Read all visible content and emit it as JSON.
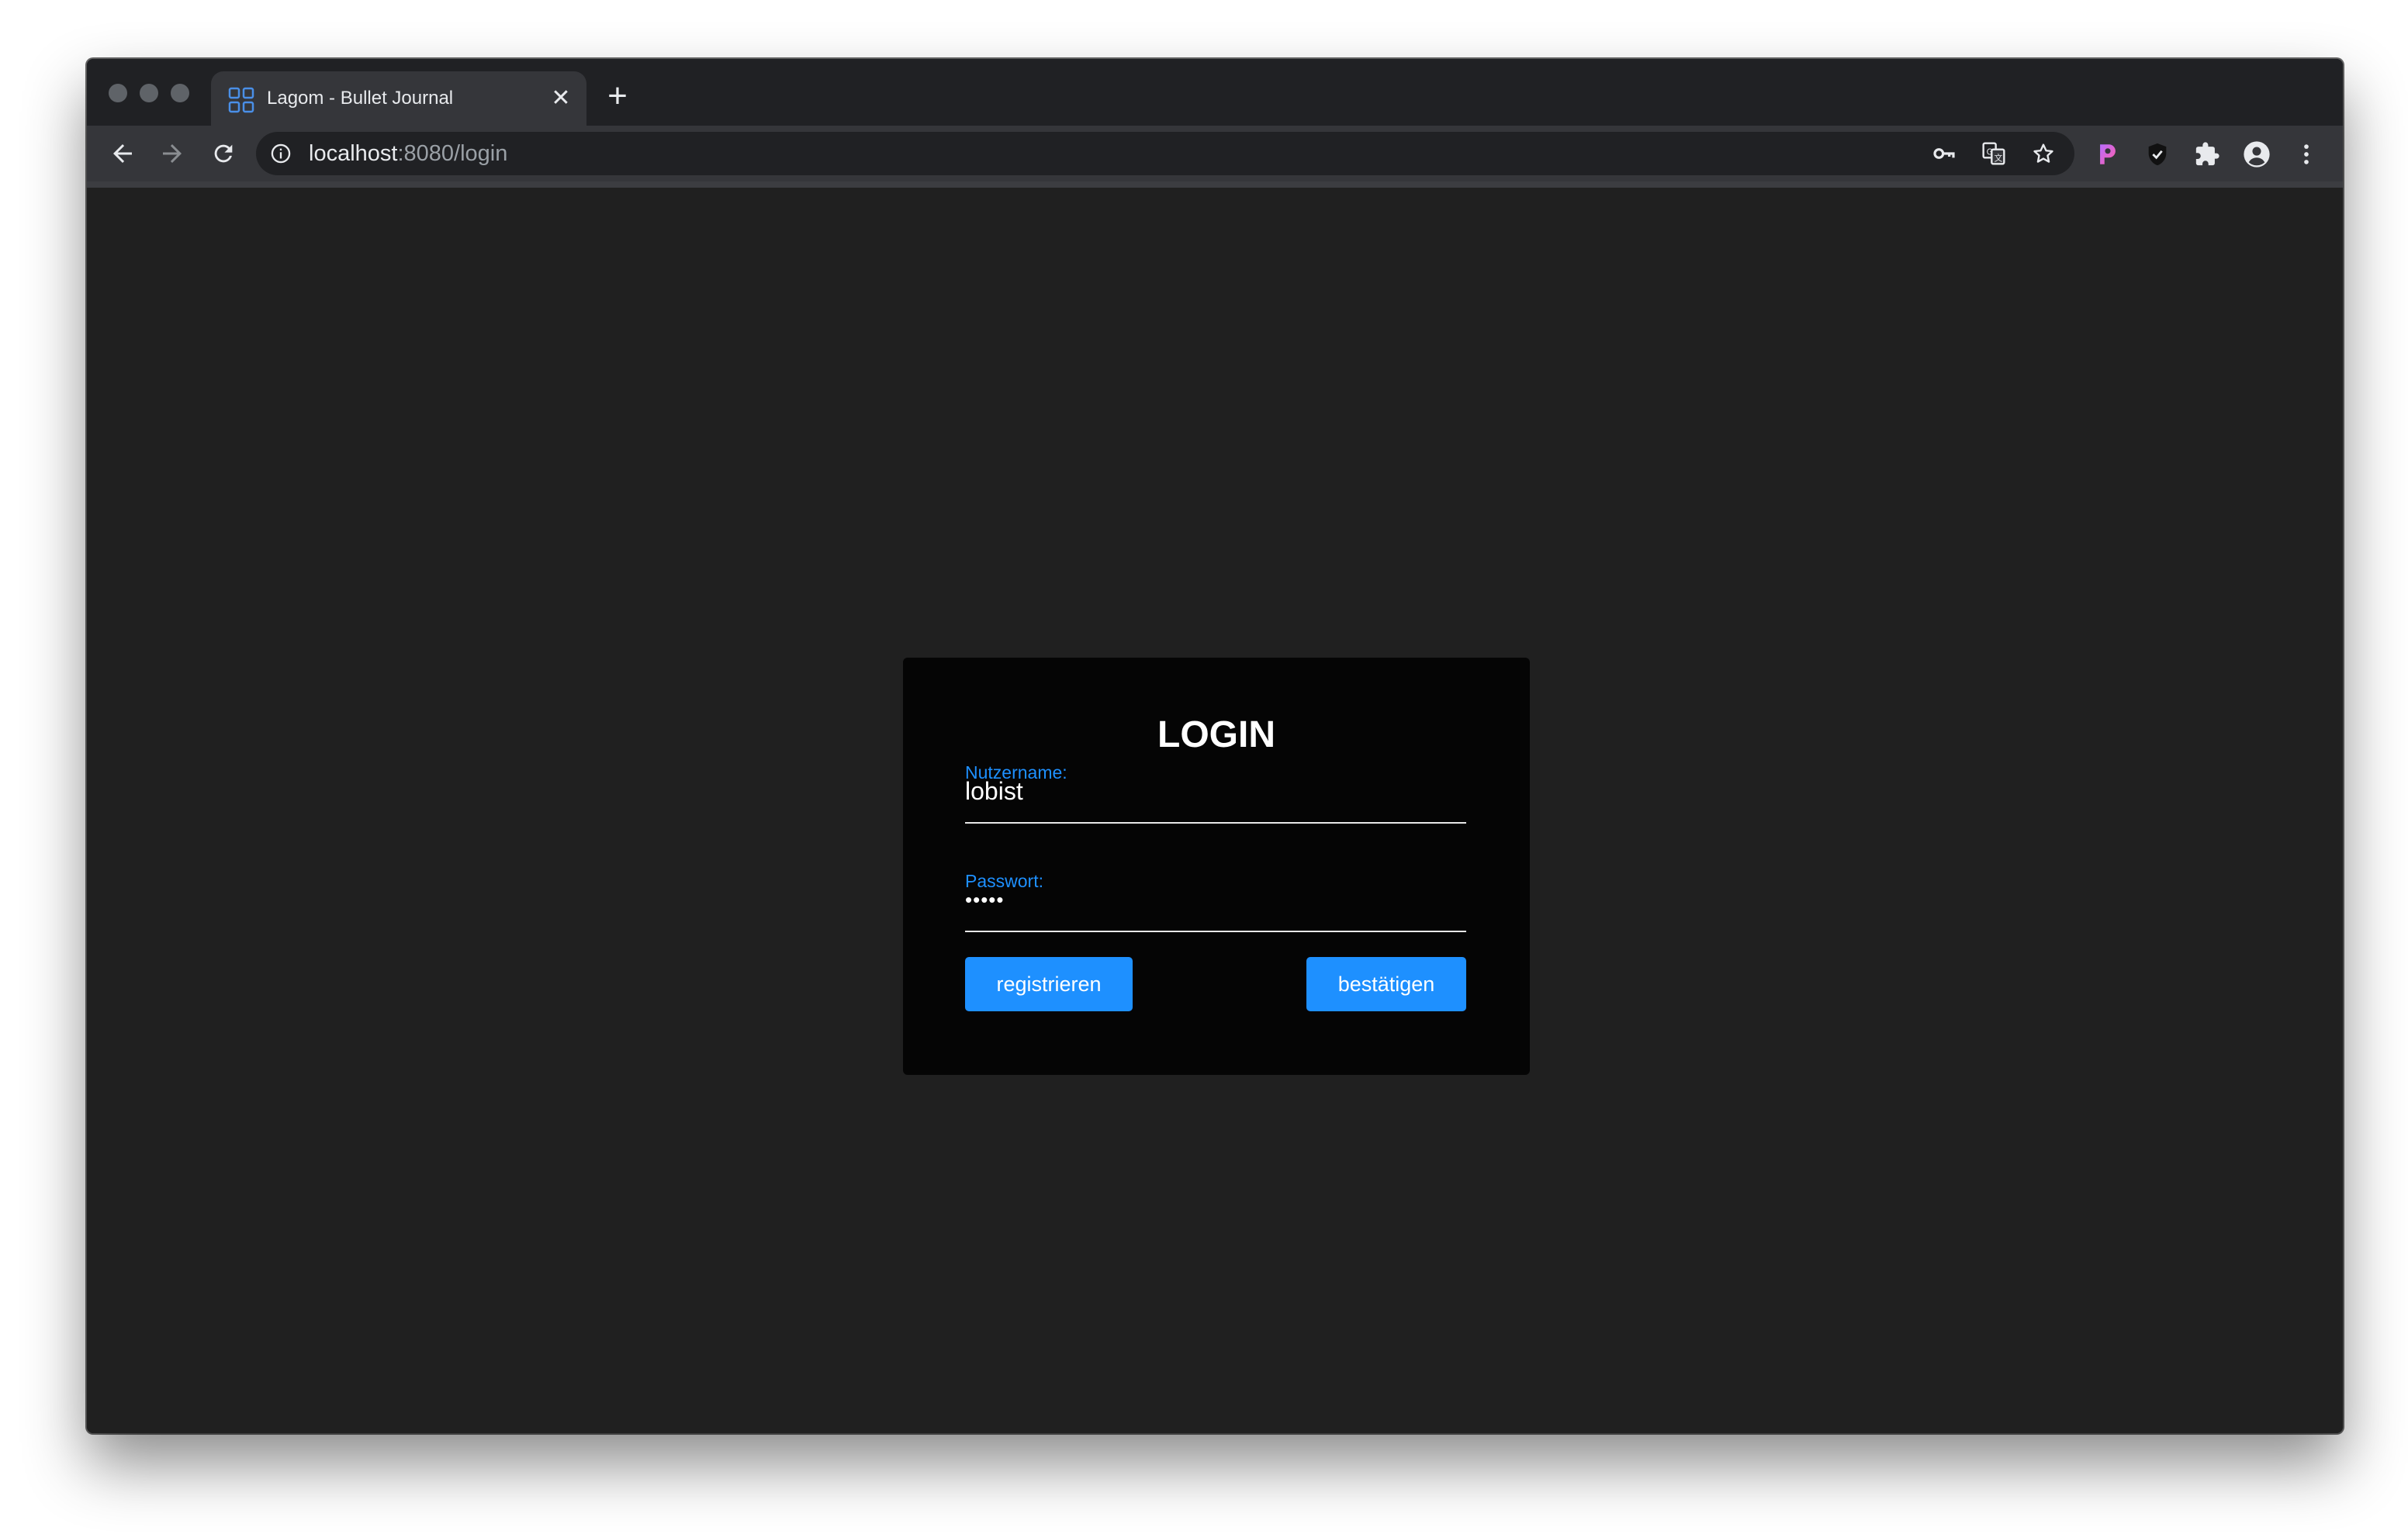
{
  "browser": {
    "tab": {
      "title": "Lagom - Bullet Journal",
      "favicon": "grid-favicon-icon",
      "close_glyph": "✕"
    },
    "new_tab_glyph": "+",
    "address": {
      "host": "localhost",
      "rest": ":8080/login"
    },
    "omnibox_icons": [
      "key-icon",
      "translate-icon",
      "star-icon"
    ],
    "extension_icons": [
      "extension-p-icon",
      "shield-icon",
      "puzzle-icon",
      "profile-icon",
      "menu-dots-icon"
    ]
  },
  "login": {
    "title": "LOGIN",
    "username_label": "Nutzername:",
    "username_value": "lobist",
    "password_label": "Passwort:",
    "password_value": "•••••",
    "register_label": "registrieren",
    "confirm_label": "bestätigen"
  },
  "colors": {
    "accent": "#1e90ff",
    "page_bg": "#202020",
    "card_bg": "#050505"
  }
}
